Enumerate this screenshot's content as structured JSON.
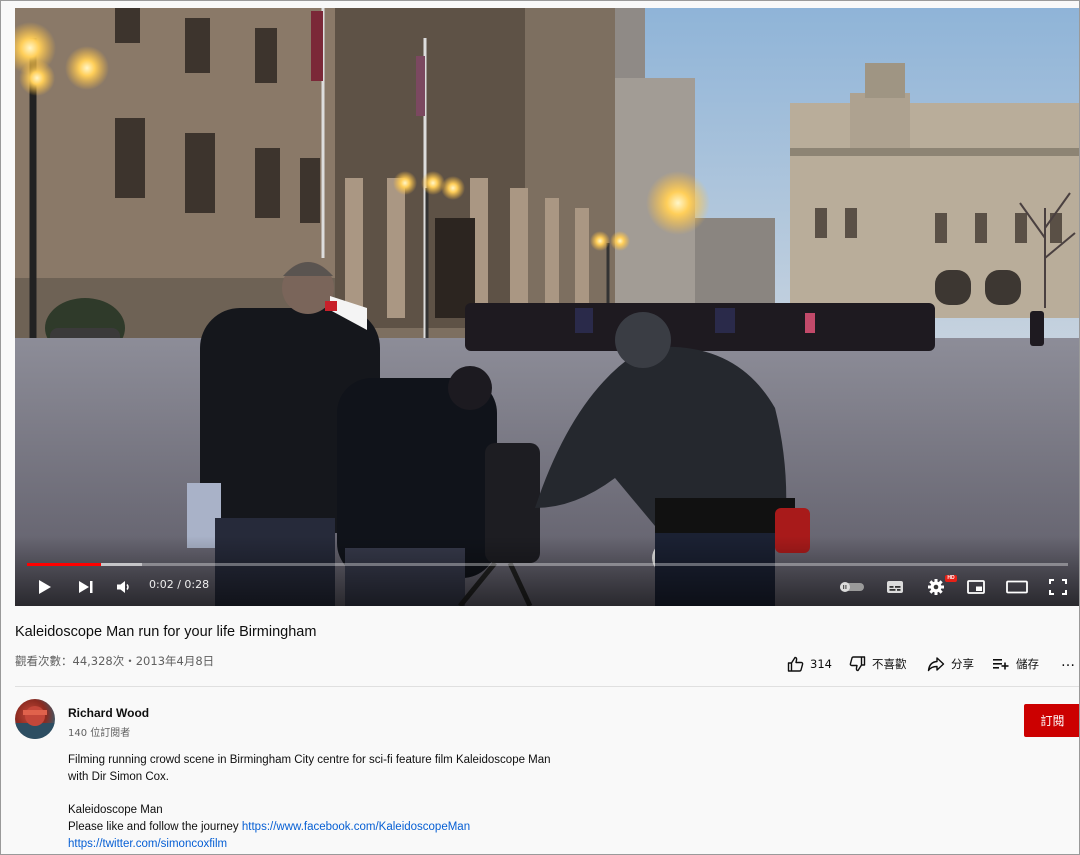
{
  "player": {
    "current_time": "0:02",
    "separator": " / ",
    "duration": "0:28",
    "progress_fraction": 0.0714,
    "buffer_fraction": 0.11,
    "icons": [
      "play-icon",
      "next-icon",
      "volume-icon",
      "autoplay-toggle-icon",
      "subtitles-icon",
      "settings-icon",
      "miniplayer-icon",
      "theater-mode-icon",
      "fullscreen-icon"
    ],
    "settings_badge": "HD"
  },
  "video": {
    "title": "Kaleidoscope Man run for your life Birmingham",
    "views_line": "觀看次數：44,328次・2013年4月8日"
  },
  "actions": {
    "like_count": "314",
    "dislike_label": "不喜歡",
    "share_label": "分享",
    "save_label": "儲存",
    "more_label": "…"
  },
  "channel": {
    "name": "Richard Wood",
    "subscribers": "140 位訂閱者",
    "subscribe_label": "訂閱"
  },
  "description": {
    "line1": "Filming running crowd scene in Birmingham City centre for sci-fi feature film Kaleidoscope Man",
    "line2": "with Dir Simon Cox.",
    "line3": "Kaleidoscope Man",
    "line4_prefix": "Please like and follow the journey ",
    "facebook_link": "https://www.facebook.com/KaleidoscopeMan",
    "twitter_link": "https://twitter.com/simoncoxfilm"
  },
  "colors": {
    "accent_red": "#ff0000",
    "subscribe_bg": "#cc0000",
    "link_blue": "#065fd4",
    "muted_text": "#606060"
  }
}
